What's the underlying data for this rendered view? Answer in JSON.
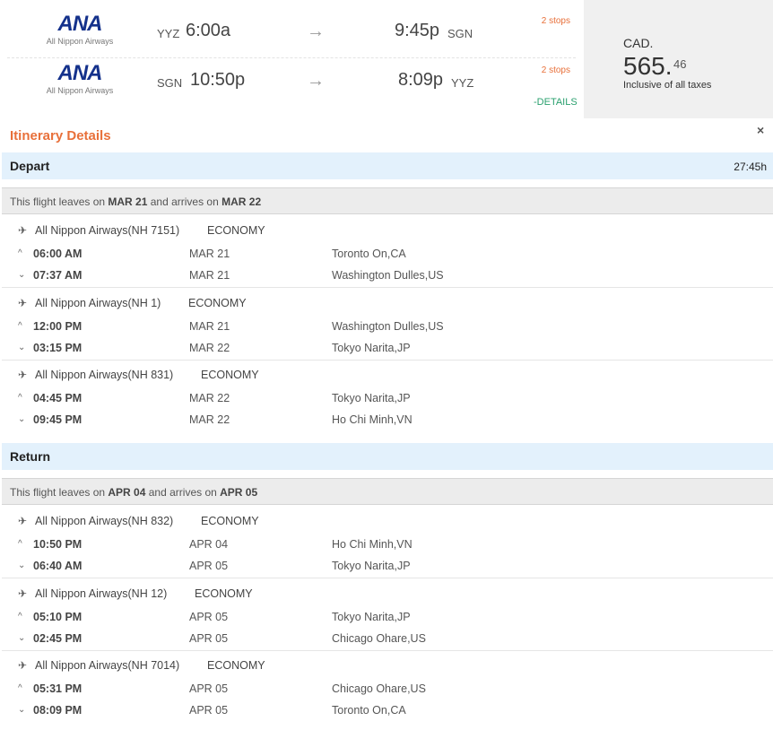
{
  "summary": {
    "legs": [
      {
        "logo": "ANA",
        "airline": "All Nippon Airways",
        "from": "YYZ",
        "dep_time": "6:00a",
        "arr_time": "9:45p",
        "to": "SGN",
        "stops": "2 stops"
      },
      {
        "logo": "ANA",
        "airline": "All Nippon Airways",
        "from": "SGN",
        "dep_time": "10:50p",
        "arr_time": "8:09p",
        "to": "YYZ",
        "stops": "2 stops"
      }
    ],
    "details_link": "-DETAILS",
    "price": {
      "currency": "CAD.",
      "amount": "565.",
      "cents": "46",
      "taxes": "Inclusive of all taxes"
    }
  },
  "itinerary": {
    "title": "Itinerary Details",
    "close": "×",
    "depart": {
      "label": "Depart",
      "duration": "27:45h",
      "leaves": {
        "pre": "This flight leaves on ",
        "d1": "MAR 21",
        "mid": " and arrives on ",
        "d2": "MAR 22"
      },
      "segments": [
        {
          "airline": "All Nippon Airways(NH 7151)",
          "cabin": "ECONOMY",
          "dep": {
            "time": "06:00 AM",
            "date": "MAR 21",
            "city": "Toronto On,CA"
          },
          "arr": {
            "time": "07:37 AM",
            "date": "MAR 21",
            "city": "Washington Dulles,US"
          }
        },
        {
          "airline": "All Nippon Airways(NH 1)",
          "cabin": "ECONOMY",
          "dep": {
            "time": "12:00 PM",
            "date": "MAR 21",
            "city": "Washington Dulles,US"
          },
          "arr": {
            "time": "03:15 PM",
            "date": "MAR 22",
            "city": "Tokyo Narita,JP"
          }
        },
        {
          "airline": "All Nippon Airways(NH 831)",
          "cabin": "ECONOMY",
          "dep": {
            "time": "04:45 PM",
            "date": "MAR 22",
            "city": "Tokyo Narita,JP"
          },
          "arr": {
            "time": "09:45 PM",
            "date": "MAR 22",
            "city": "Ho Chi Minh,VN"
          }
        }
      ]
    },
    "return": {
      "label": "Return",
      "leaves": {
        "pre": "This flight leaves on ",
        "d1": "APR 04",
        "mid": " and arrives on ",
        "d2": "APR 05"
      },
      "segments": [
        {
          "airline": "All Nippon Airways(NH 832)",
          "cabin": "ECONOMY",
          "dep": {
            "time": "10:50 PM",
            "date": "APR 04",
            "city": "Ho Chi Minh,VN"
          },
          "arr": {
            "time": "06:40 AM",
            "date": "APR 05",
            "city": "Tokyo Narita,JP"
          }
        },
        {
          "airline": "All Nippon Airways(NH 12)",
          "cabin": "ECONOMY",
          "dep": {
            "time": "05:10 PM",
            "date": "APR 05",
            "city": "Tokyo Narita,JP"
          },
          "arr": {
            "time": "02:45 PM",
            "date": "APR 05",
            "city": "Chicago Ohare,US"
          }
        },
        {
          "airline": "All Nippon Airways(NH 7014)",
          "cabin": "ECONOMY",
          "dep": {
            "time": "05:31 PM",
            "date": "APR 05",
            "city": "Chicago Ohare,US"
          },
          "arr": {
            "time": "08:09 PM",
            "date": "APR 05",
            "city": "Toronto On,CA"
          }
        }
      ]
    }
  },
  "icons": {
    "plane": "plane-icon",
    "up": "chevron-up-icon",
    "down": "chevron-down-icon",
    "arrow": "arrow-right-icon"
  },
  "colors": {
    "accent": "#e8703a",
    "link": "#2aa06e",
    "header_bg": "#e3f1fc",
    "brand": "#14318b"
  }
}
